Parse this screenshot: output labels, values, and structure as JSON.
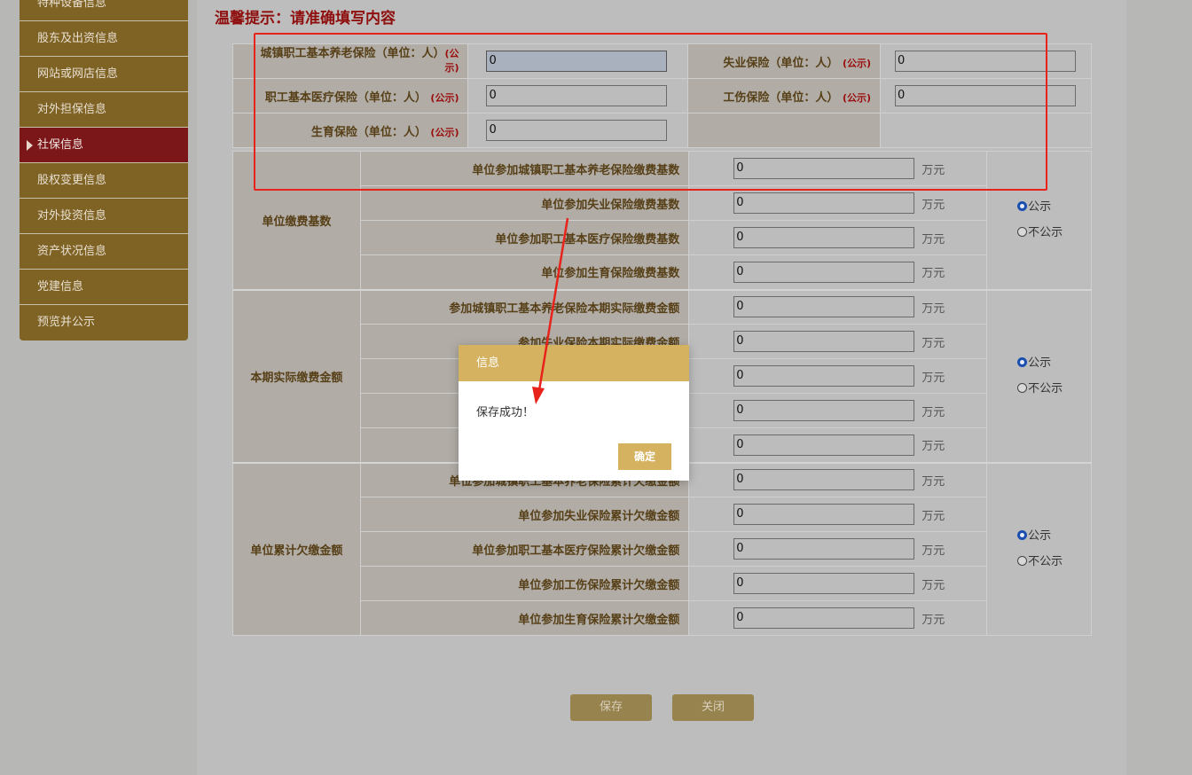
{
  "sidebar": {
    "items": [
      {
        "label": "特种设备信息",
        "active": false
      },
      {
        "label": "股东及出资信息",
        "active": false
      },
      {
        "label": "网站或网店信息",
        "active": false
      },
      {
        "label": "对外担保信息",
        "active": false
      },
      {
        "label": "社保信息",
        "active": true
      },
      {
        "label": "股权变更信息",
        "active": false
      },
      {
        "label": "对外投资信息",
        "active": false
      },
      {
        "label": "资产状况信息",
        "active": false
      },
      {
        "label": "党建信息",
        "active": false
      },
      {
        "label": "预览并公示",
        "active": false
      }
    ]
  },
  "tip": "温馨提示：请准确填写内容",
  "top_fields": {
    "pension_label": "城镇职工基本养老保险（单位：人）",
    "pension_value": "0",
    "unemployment_label": "失业保险（单位：人）",
    "unemployment_value": "0",
    "medical_label": "职工基本医疗保险（单位：人）",
    "medical_value": "0",
    "injury_label": "工伤保险（单位：人）",
    "injury_value": "0",
    "maternity_label": "生育保险（单位：人）",
    "maternity_value": "0",
    "public_tag": "(公示)",
    "public_tag_split_1": "(公",
    "public_tag_split_2": "示)"
  },
  "unit": "万元",
  "radio": {
    "public": "公示",
    "not_public": "不公示"
  },
  "groups": {
    "base": {
      "title": "单位缴费基数",
      "rows": [
        {
          "label": "单位参加城镇职工基本养老保险缴费基数",
          "value": "0"
        },
        {
          "label": "单位参加失业保险缴费基数",
          "value": "0"
        },
        {
          "label": "单位参加职工基本医疗保险缴费基数",
          "value": "0"
        },
        {
          "label": "单位参加生育保险缴费基数",
          "value": "0"
        }
      ]
    },
    "actual": {
      "title": "本期实际缴费金额",
      "rows": [
        {
          "label": "参加城镇职工基本养老保险本期实际缴费金额",
          "value": "0"
        },
        {
          "label": "参加失业保险本期实际缴费金额",
          "value": "0"
        },
        {
          "label": "",
          "value": "0"
        },
        {
          "label": "",
          "value": "0"
        },
        {
          "label": "",
          "value": "0"
        }
      ]
    },
    "arrears": {
      "title": "单位累计欠缴金额",
      "rows": [
        {
          "label": "单位参加城镇职工基本养老保险累计欠缴金额",
          "value": "0"
        },
        {
          "label": "单位参加失业保险累计欠缴金额",
          "value": "0"
        },
        {
          "label": "单位参加职工基本医疗保险累计欠缴金额",
          "value": "0"
        },
        {
          "label": "单位参加工伤保险累计欠缴金额",
          "value": "0"
        },
        {
          "label": "单位参加生育保险累计欠缴金额",
          "value": "0"
        }
      ]
    }
  },
  "buttons": {
    "save": "保存",
    "close": "关闭"
  },
  "dialog": {
    "title": "信息",
    "message": "保存成功！",
    "ok": "确定"
  },
  "colors": {
    "annotation": "#e8231b",
    "sidebar": "#7f6325",
    "sidebar_active": "#7b1619",
    "dialog_header": "#d4b260"
  }
}
